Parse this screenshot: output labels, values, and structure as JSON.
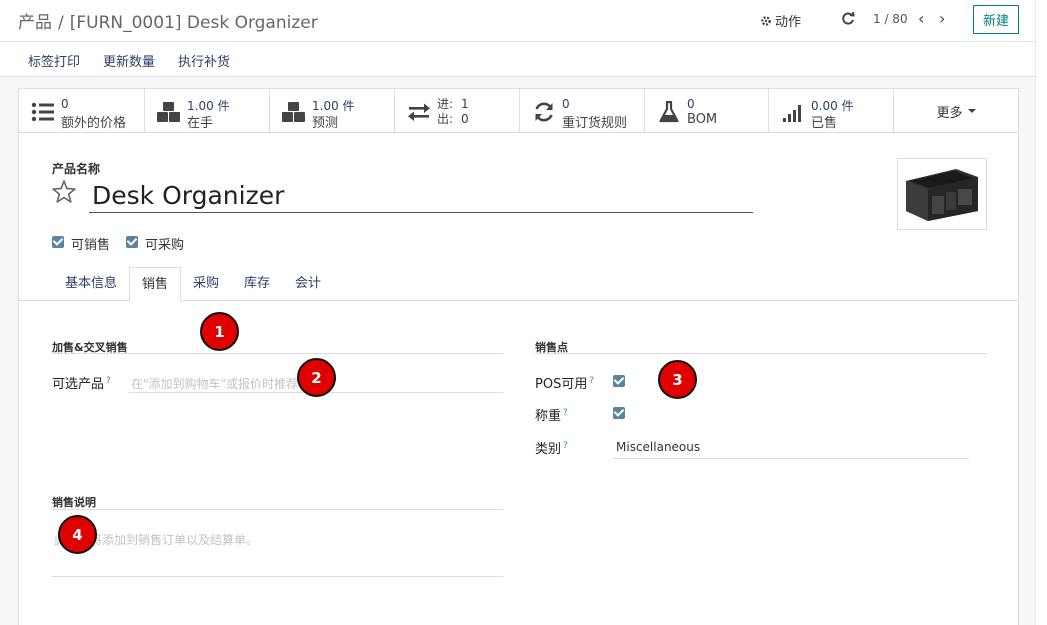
{
  "breadcrumb": {
    "parent": "产品",
    "separator": "/",
    "current": "[FURN_0001] Desk Organizer"
  },
  "control": {
    "action_label": "动作",
    "pager_value": "1 / 80",
    "new_label": "新建"
  },
  "action_bar": {
    "print_labels": "标签打印",
    "update_qty": "更新数量",
    "replenish": "执行补货"
  },
  "stats": {
    "extra_prices": {
      "value": "0",
      "label": "额外的价格",
      "icon": "list-icon"
    },
    "on_hand": {
      "value": "1.00 件",
      "label": "在手",
      "icon": "cubes-icon"
    },
    "forecast": {
      "value": "1.00 件",
      "label": "预测",
      "icon": "cubes-icon"
    },
    "in_out": {
      "in_label": "进:",
      "in_value": "1",
      "out_label": "出:",
      "out_value": "0",
      "icon": "exchange-icon"
    },
    "reorder": {
      "value": "0",
      "label": "重订货规则",
      "icon": "refresh-icon"
    },
    "bom": {
      "value": "0",
      "label": "BOM",
      "icon": "flask-icon"
    },
    "sold": {
      "value": "0.00 件",
      "label": "已售",
      "icon": "signal-icon"
    },
    "more_label": "更多"
  },
  "product": {
    "name_label": "产品名称",
    "name": "Desk Organizer",
    "can_sell_label": "可销售",
    "can_purchase_label": "可采购"
  },
  "tabs": [
    "基本信息",
    "销售",
    "采购",
    "库存",
    "会计"
  ],
  "sales": {
    "upsell_title": "加售&交叉销售",
    "optional_label": "可选产品",
    "optional_help": "?",
    "optional_placeholder": "在\"添加到购物车\"或报价时推荐",
    "pos_title": "销售点",
    "pos_label": "POS可用",
    "weigh_label": "称重",
    "category_label": "类别",
    "help_mark": "?",
    "category_value": "Miscellaneous",
    "desc_title": "销售说明",
    "desc_placeholder": "此说明将添加到销售订单以及结算单。"
  },
  "annotations": [
    "1",
    "2",
    "3",
    "4"
  ],
  "colors": {
    "link": "#2d3e6a",
    "primary": "#017e84",
    "checkbox": "#5a84a0",
    "badge": "#e00000"
  }
}
